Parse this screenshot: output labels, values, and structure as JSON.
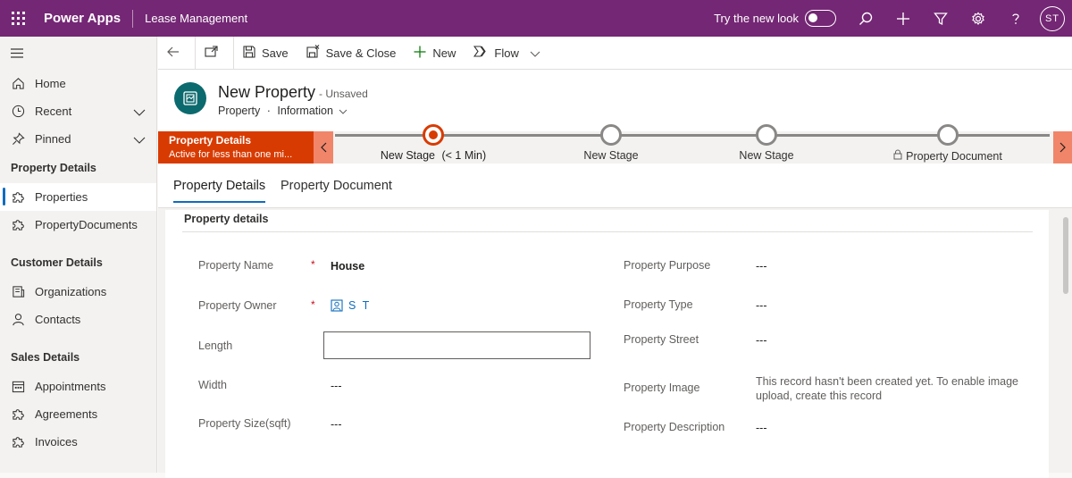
{
  "topbar": {
    "brand": "Power Apps",
    "app_name": "Lease Management",
    "try_new_look": "Try the new look",
    "avatar_initials": "ST",
    "color": "#742774"
  },
  "sidebar": {
    "items": [
      {
        "label": "Home",
        "icon": "home-icon"
      },
      {
        "label": "Recent",
        "icon": "clock-icon"
      },
      {
        "label": "Pinned",
        "icon": "pin-icon"
      }
    ],
    "groups": [
      {
        "header": "Property Details",
        "items": [
          {
            "label": "Properties",
            "icon": "puzzle-icon",
            "selected": true
          },
          {
            "label": "PropertyDocuments",
            "icon": "puzzle-icon"
          }
        ]
      },
      {
        "header": "Customer Details",
        "items": [
          {
            "label": "Organizations",
            "icon": "organization-icon"
          },
          {
            "label": "Contacts",
            "icon": "person-icon"
          }
        ]
      },
      {
        "header": "Sales Details",
        "items": [
          {
            "label": "Appointments",
            "icon": "calendar-icon"
          },
          {
            "label": "Agreements",
            "icon": "puzzle-icon"
          },
          {
            "label": "Invoices",
            "icon": "puzzle-icon"
          }
        ]
      }
    ]
  },
  "commandbar": {
    "save": "Save",
    "save_close": "Save & Close",
    "new": "New",
    "flow": "Flow"
  },
  "record": {
    "title": "New Property",
    "status": "- Unsaved",
    "entity": "Property",
    "separator": "·",
    "form": "Information"
  },
  "bpf": {
    "active_stage_name": "Property Details",
    "active_duration": "Active for less than one mi...",
    "accent": "#d83b01",
    "stages": [
      {
        "label": "New Stage",
        "duration": "(< 1 Min)",
        "active": true
      },
      {
        "label": "New Stage"
      },
      {
        "label": "New Stage"
      },
      {
        "label": "Property Document",
        "locked": true
      }
    ]
  },
  "tabs": [
    {
      "label": "Property Details",
      "active": true
    },
    {
      "label": "Property Document"
    }
  ],
  "section": {
    "title": "Property details",
    "left_fields": [
      {
        "label": "Property Name",
        "required": "*",
        "value": "House"
      },
      {
        "label": "Property Owner",
        "required": "*",
        "value": "S T"
      },
      {
        "label": "Length",
        "value": ""
      },
      {
        "label": "Width",
        "value": "---"
      },
      {
        "label": "Property Size(sqft)",
        "value": "---"
      }
    ],
    "right_fields": [
      {
        "label": "Property Purpose",
        "value": "---"
      },
      {
        "label": "Property Type",
        "value": "---"
      },
      {
        "label": "Property Street",
        "value": "---"
      },
      {
        "label": "Property Image",
        "value": "This record hasn't been created yet. To enable image upload, create this record"
      },
      {
        "label": "Property Description",
        "value": "---"
      }
    ]
  }
}
